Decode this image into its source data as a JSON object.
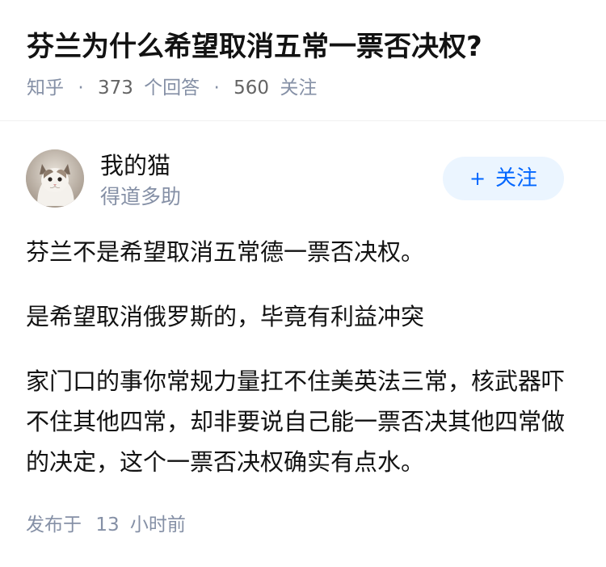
{
  "question": {
    "title": "芬兰为什么希望取消五常一票否决权?",
    "source": "知乎",
    "answer_count": "373",
    "answer_label": "个回答",
    "follow_count": "560",
    "follow_label": "关注"
  },
  "answer": {
    "author": {
      "name": "我的猫",
      "bio": "得道多助",
      "avatar_icon": "cat-avatar"
    },
    "follow_button": {
      "plus": "+",
      "label": "关注"
    },
    "paragraphs": [
      "芬兰不是希望取消五常德一票否决权。",
      "是希望取消俄罗斯的，毕竟有利益冲突",
      "家门口的事你常规力量扛不住美英法三常，核武器吓不住其他四常，却非要说自己能一票否决其他四常做的决定，这个一票否决权确实有点水。"
    ],
    "publish": {
      "prefix": "发布于",
      "number": "13",
      "unit": "小时前"
    }
  },
  "colors": {
    "accent": "#0066ff",
    "button_bg": "#ebf5ff",
    "meta": "#8590a6",
    "text": "#121212"
  }
}
